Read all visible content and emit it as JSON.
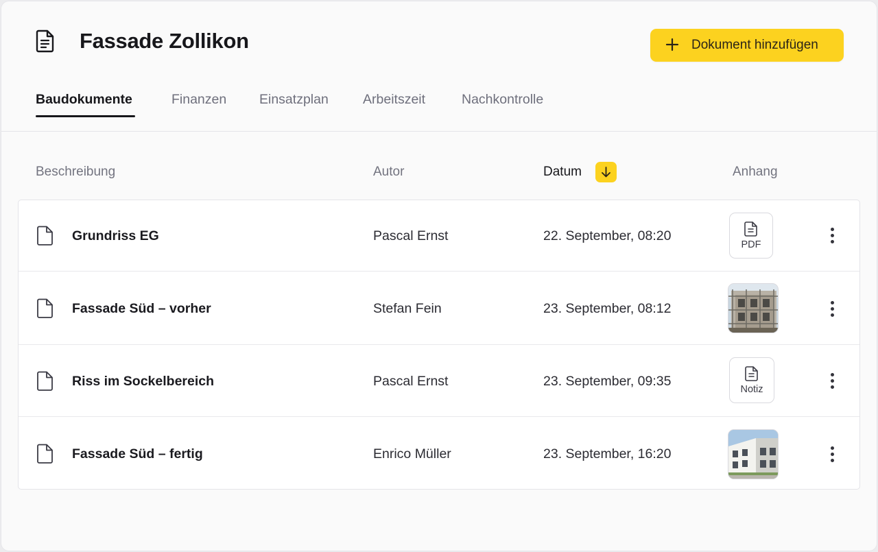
{
  "page": {
    "title": "Fassade Zollikon",
    "icon": "document-icon"
  },
  "actions": {
    "add_document_label": "Dokument hinzufügen",
    "add_icon": "plus-icon"
  },
  "tabs": [
    {
      "label": "Baudokumente",
      "active": true
    },
    {
      "label": "Finanzen",
      "active": false
    },
    {
      "label": "Einsatzplan",
      "active": false
    },
    {
      "label": "Arbeitszeit",
      "active": false
    },
    {
      "label": "Nachkontrolle",
      "active": false
    }
  ],
  "table": {
    "columns": {
      "description": "Beschreibung",
      "author": "Autor",
      "date": "Datum",
      "attachment": "Anhang"
    },
    "sort": {
      "column": "date",
      "direction": "descending",
      "icon": "arrow-down-icon"
    },
    "rows": [
      {
        "title": "Grundriss EG",
        "author": "Pascal Ernst",
        "date": "22. September, 08:20",
        "attachment": {
          "type": "file",
          "label": "PDF"
        }
      },
      {
        "title": "Fassade Süd – vorher",
        "author": "Stefan Fein",
        "date": "23. September, 08:12",
        "attachment": {
          "type": "photo",
          "subject": "scaffolded building facade"
        }
      },
      {
        "title": "Riss im Sockelbereich",
        "author": "Pascal Ernst",
        "date": "23. September, 09:35",
        "attachment": {
          "type": "file",
          "label": "Notiz"
        }
      },
      {
        "title": "Fassade Süd – fertig",
        "author": "Enrico Müller",
        "date": "23. September, 16:20",
        "attachment": {
          "type": "photo",
          "subject": "finished building facade"
        }
      }
    ]
  },
  "colors": {
    "accent": "#fcd21f",
    "text": "#17171b",
    "muted": "#6e6f7c",
    "border": "#e4e4e8"
  }
}
